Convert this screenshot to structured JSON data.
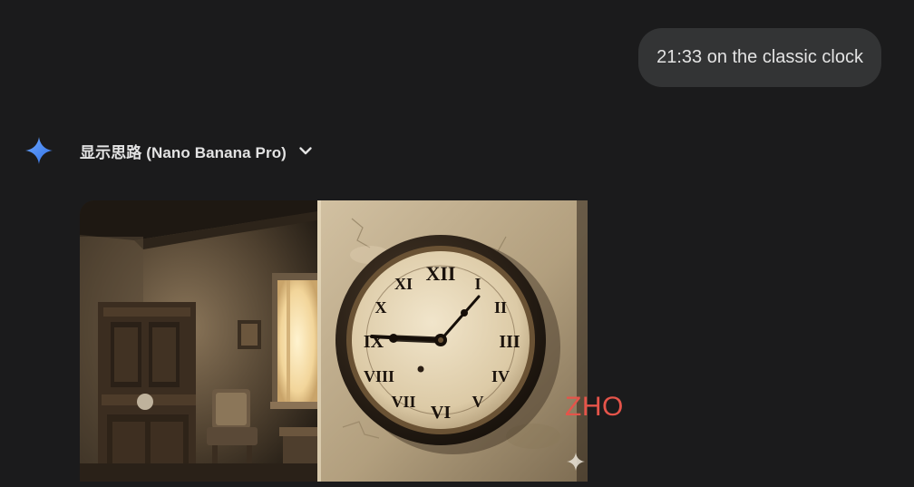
{
  "conversation": {
    "user_message": "21:33 on the classic clock",
    "model": {
      "thoughts_toggle_label": "显示思路 (Nano Banana Pro)",
      "image": {
        "alt": "Antique wall clock on a plaster wall in a dim vintage room",
        "watermark_text": "ZHO"
      }
    }
  },
  "icons": {
    "assistant": "gemini-sparkle-icon",
    "expand": "chevron-down-icon",
    "image_mark": "gemini-sparkle-icon"
  },
  "colors": {
    "background": "#1b1b1c",
    "bubble": "#333435",
    "text": "#e3e3e3",
    "sparkle": "#4a8df8",
    "watermark": "#e5544a"
  }
}
